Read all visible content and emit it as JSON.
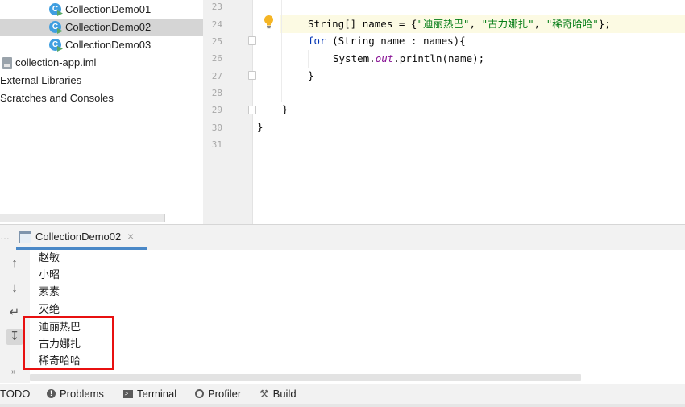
{
  "project_tree": {
    "items": [
      {
        "label": "CollectionDemo01",
        "icon": "java-class-icon"
      },
      {
        "label": "CollectionDemo02",
        "icon": "java-class-icon",
        "selected": true
      },
      {
        "label": "CollectionDemo03",
        "icon": "java-class-icon"
      },
      {
        "label": "collection-app.iml",
        "icon": "iml-file-icon"
      },
      {
        "label": "External Libraries",
        "icon": ""
      },
      {
        "label": "Scratches and Consoles",
        "icon": ""
      }
    ]
  },
  "editor": {
    "line_numbers": [
      "23",
      "24",
      "25",
      "26",
      "27",
      "28",
      "29",
      "30",
      "31"
    ],
    "code": {
      "line24_type": "String[] names = {",
      "line24_s1": "\"迪丽热巴\"",
      "line24_sep1": ", ",
      "line24_s2": "\"古力娜扎\"",
      "line24_sep2": ", ",
      "line24_s3": "\"稀奇哈哈\"",
      "line24_end": "};",
      "line25_for": "for",
      "line25_rest": " (String name : names){",
      "line26_sys": "System.",
      "line26_out": "out",
      "line26_rest": ".println(name);",
      "line27": "}",
      "line29": "}",
      "line30": "}"
    },
    "intention_icon": "lightbulb-icon"
  },
  "run_window": {
    "left_label": "…",
    "tab_label": "CollectionDemo02",
    "tab_close": "×",
    "toolbar": {
      "up": "↑",
      "down": "↓",
      "wrap": "↵",
      "scroll_end": "↧",
      "more": "»"
    },
    "output_lines": [
      "赵敏",
      "小昭",
      "素素",
      "灭绝",
      "迪丽热巴",
      "古力娜扎",
      "稀奇哈哈"
    ]
  },
  "bottom_bar": {
    "todo": "TODO",
    "problems": "Problems",
    "terminal": "Terminal",
    "profiler": "Profiler",
    "build": "Build",
    "problems_glyph": "!",
    "terminal_glyph": ">_",
    "build_glyph": "⚒"
  },
  "colors": {
    "accent": "#4a88c7",
    "highlight_box": "#e81010",
    "keyword": "#0033b3",
    "string": "#067d17"
  }
}
